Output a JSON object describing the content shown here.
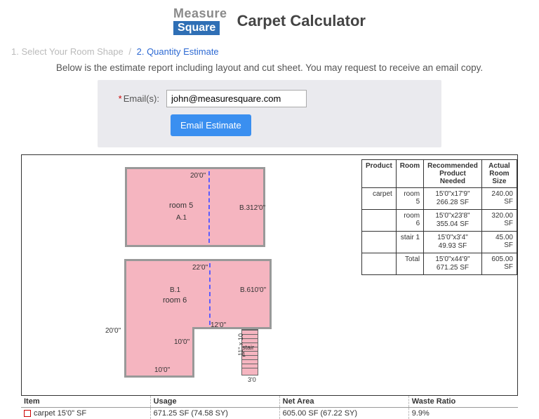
{
  "logo": {
    "top": "Measure",
    "bottom": "Square",
    "title": "Carpet Calculator"
  },
  "steps": {
    "s1": "1. Select Your Room Shape",
    "sep": "/",
    "s2": "2. Quantity Estimate"
  },
  "intro": "Below is the estimate report including layout and cut sheet. You may request to receive an email copy.",
  "email": {
    "label": "Email(s):",
    "value": "john@measuresquare.com",
    "button": "Email Estimate"
  },
  "rooms": {
    "r5": {
      "top": "20'0\"",
      "name": "room 5",
      "a1": "A.1",
      "right": "12'0\"",
      "bdot": "B.3"
    },
    "r6": {
      "top": "22'0\"",
      "b1": "B.1",
      "name": "room 6",
      "bdim": "B.610'0\"",
      "inner": "12'0\"",
      "left": "20'0\"",
      "inner10": "10'0\"",
      "bottom": "10'0\""
    },
    "stair": {
      "name": "stair 1",
      "dim": "11\" x 10",
      "bottom": "3'0"
    }
  },
  "ptable": {
    "headers": {
      "product": "Product",
      "room": "Room",
      "rec": "Recommended Product Needed",
      "size": "Actual Room Size"
    },
    "rows": [
      {
        "product": "carpet",
        "room": "room 5",
        "rec1": "15'0\"x17'9\"",
        "rec2": "266.28 SF",
        "size": "240.00 SF"
      },
      {
        "product": "",
        "room": "room 6",
        "rec1": "15'0\"x23'8\"",
        "rec2": "355.04 SF",
        "size": "320.00 SF"
      },
      {
        "product": "",
        "room": "stair 1",
        "rec1": "15'0\"x3'4\"",
        "rec2": "49.93 SF",
        "size": "45.00 SF"
      },
      {
        "product": "",
        "room": "Total",
        "rec1": "15'0\"x44'9\"",
        "rec2": "671.25 SF",
        "size": "605.00 SF"
      }
    ]
  },
  "summary": {
    "headers": {
      "item": "Item",
      "usage": "Usage",
      "net": "Net Area",
      "waste": "Waste Ratio"
    },
    "row": {
      "item": "carpet 15'0\" SF",
      "usage": "671.25 SF (74.58 SY)",
      "net": "605.00 SF (67.22 SY)",
      "waste": "9.9%"
    }
  }
}
